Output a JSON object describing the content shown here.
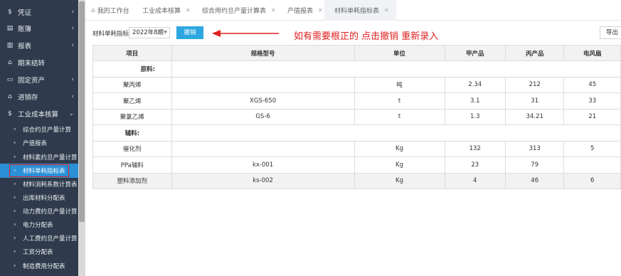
{
  "sidebar": {
    "sections": [
      {
        "label": "凭证",
        "icon": "dollar-icon",
        "glyph": "$"
      },
      {
        "label": "账簿",
        "icon": "list-icon",
        "glyph": "▤"
      },
      {
        "label": "报表",
        "icon": "report-icon",
        "glyph": "▥"
      },
      {
        "label": "期末结转",
        "icon": "settlement-icon",
        "glyph": "⌂"
      },
      {
        "label": "固定资产",
        "icon": "monitor-icon",
        "glyph": "▭"
      },
      {
        "label": "进销存",
        "icon": "inventory-icon",
        "glyph": "⌂"
      },
      {
        "label": "工业成本核算",
        "icon": "dollar-icon",
        "glyph": "$"
      }
    ],
    "subitems": [
      {
        "label": "综合约旦产量计算"
      },
      {
        "label": "产值报表"
      },
      {
        "label": "材料素约旦产量计算"
      },
      {
        "label": "材料单耗指标表"
      },
      {
        "label": "材料消耗系数计算表"
      },
      {
        "label": "出库材料分配表"
      },
      {
        "label": "动力费约旦产量计算"
      },
      {
        "label": "电力分配表"
      },
      {
        "label": "人工费约旦产量计算"
      },
      {
        "label": "工资分配表"
      },
      {
        "label": "制造费用分配表"
      }
    ],
    "active_subitem_index": 3
  },
  "tabs": [
    {
      "label": "我的工作台",
      "closable": false
    },
    {
      "label": "工业成本核算",
      "closable": true
    },
    {
      "label": "综合用约旦产量计算表",
      "closable": true
    },
    {
      "label": "产值报表",
      "closable": true
    },
    {
      "label": "材料单耗指标表",
      "closable": true,
      "active": true
    }
  ],
  "toolbar": {
    "label": "材料单耗指标",
    "period_value": "2022年8期",
    "undo_label": "撤销",
    "export_label": "导出"
  },
  "annotation": {
    "text": "如有需要根正的  点击撤销  重新录入",
    "color": "#e02020"
  },
  "table": {
    "headers": [
      "项目",
      "规格型号",
      "单位",
      "甲产品",
      "丙产品",
      "电风扇"
    ],
    "rows": [
      {
        "type": "section",
        "cells": [
          "原料:"
        ]
      },
      {
        "type": "data",
        "cells": [
          "聚丙烯",
          "",
          "吨",
          "2.34",
          "212",
          "45"
        ]
      },
      {
        "type": "data",
        "cells": [
          "聚乙烯",
          "XGS-650",
          "t",
          "3.1",
          "31",
          "33"
        ]
      },
      {
        "type": "data",
        "cells": [
          "聚氯乙烯",
          "GS-6",
          "t",
          "1.3",
          "34.21",
          "21"
        ]
      },
      {
        "type": "section",
        "cells": [
          "辅料:"
        ]
      },
      {
        "type": "data",
        "cells": [
          "催化剂",
          "",
          "Kg",
          "132",
          "313",
          "5"
        ]
      },
      {
        "type": "data",
        "cells": [
          "PPa辅料",
          "kx-001",
          "Kg",
          "23",
          "79",
          ""
        ]
      },
      {
        "type": "data",
        "gray": true,
        "cells": [
          "塑料添加剂",
          "ks-002",
          "Kg",
          "4",
          "46",
          "6"
        ]
      }
    ]
  },
  "colors": {
    "sidebar_bg": "#2f3b4c",
    "active_item": "#2b8fd6",
    "button_blue": "#2ea7e0",
    "highlight_red": "#e02020"
  }
}
